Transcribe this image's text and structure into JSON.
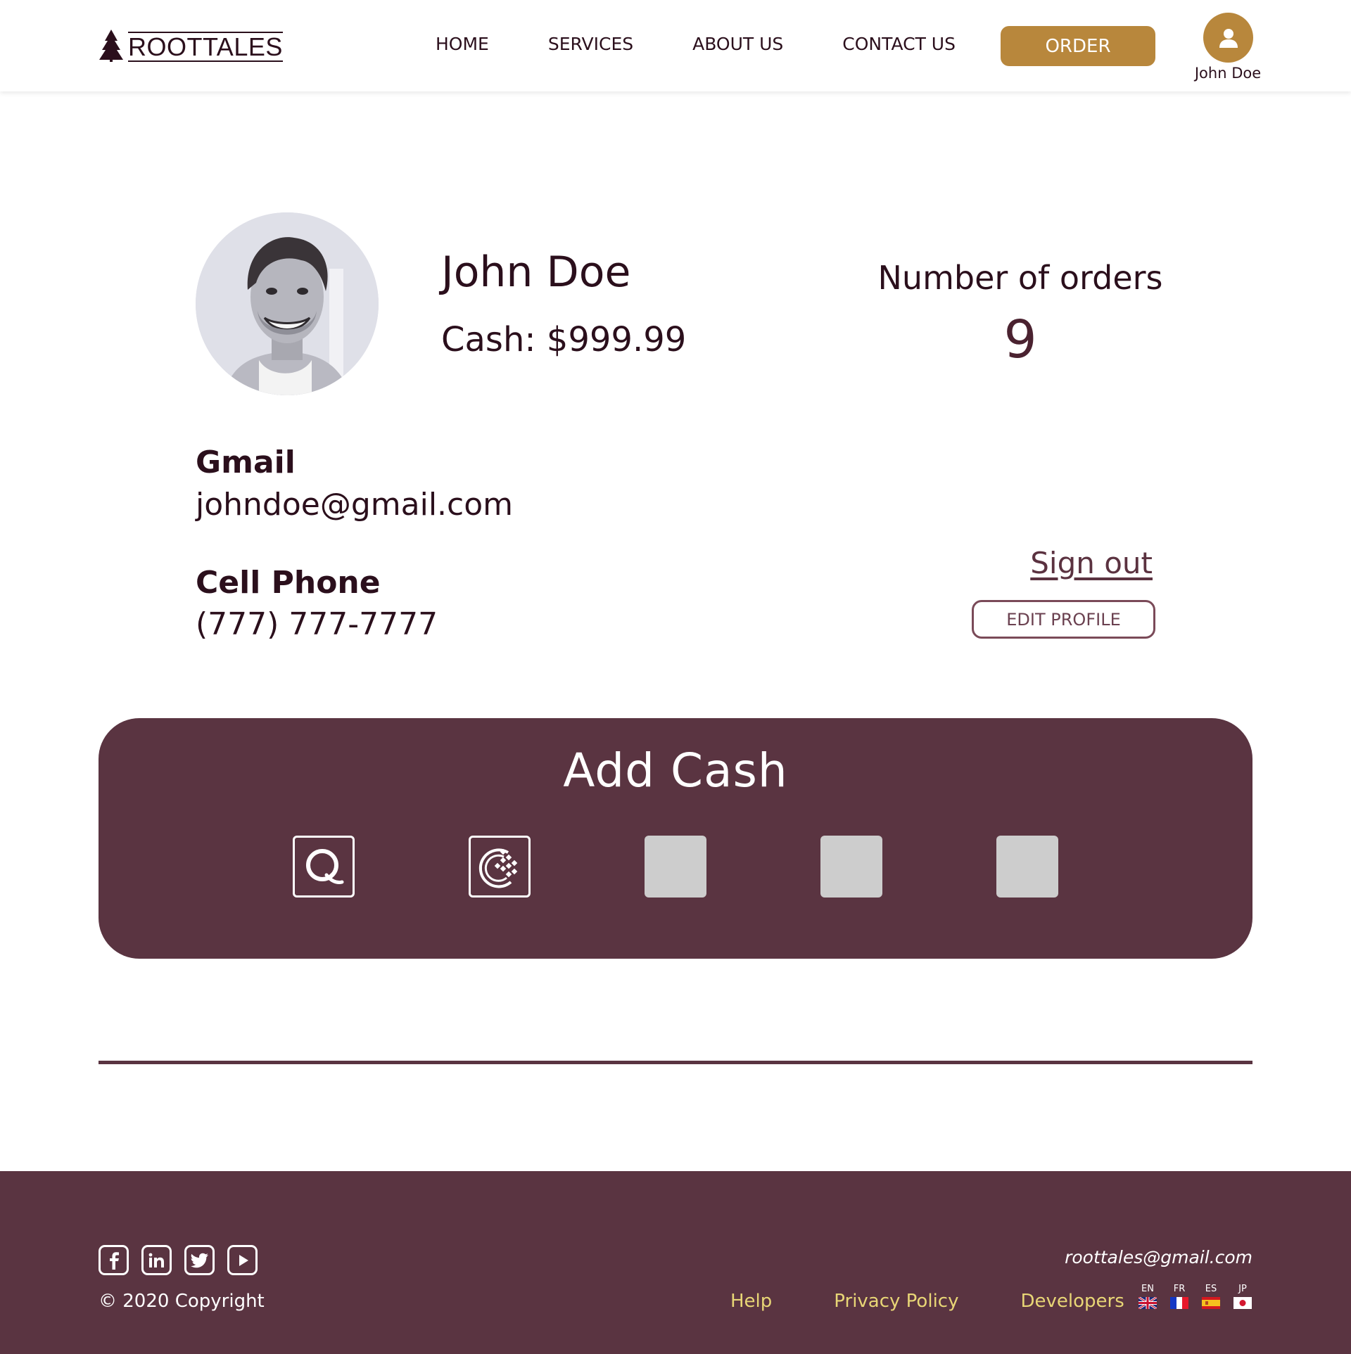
{
  "header": {
    "logo_text": "ROOTTALES",
    "nav": [
      "HOME",
      "SERVICES",
      "ABOUT US",
      "CONTACT US"
    ],
    "order_label": "ORDER",
    "user_name": "John Doe"
  },
  "profile": {
    "name": "John Doe",
    "cash": "Cash: $999.99",
    "orders_label": "Number of orders",
    "orders_count": "9",
    "email_label": "Gmail",
    "email_value": "johndoe@gmail.com",
    "phone_label": "Cell Phone",
    "phone_value": "(777) 777-7777",
    "signout_label": "Sign out",
    "edit_label": "EDIT PROFILE"
  },
  "add_cash": {
    "title": "Add Cash",
    "methods": [
      "qiwi-icon",
      "webmoney-icon",
      "payment-placeholder",
      "payment-placeholder",
      "payment-placeholder"
    ]
  },
  "footer": {
    "social": [
      "facebook-icon",
      "linkedin-icon",
      "twitter-icon",
      "youtube-icon"
    ],
    "copyright": "© 2020 Copyright",
    "email": "roottales@gmail.com",
    "links": [
      "Help",
      "Privacy Policy",
      "Developers"
    ],
    "languages": [
      "EN",
      "FR",
      "ES",
      "JP"
    ]
  },
  "colors": {
    "accent": "#b8873c",
    "brand": "#5a3441",
    "text": "#2b0f1c",
    "footer_link": "#e8d676"
  }
}
